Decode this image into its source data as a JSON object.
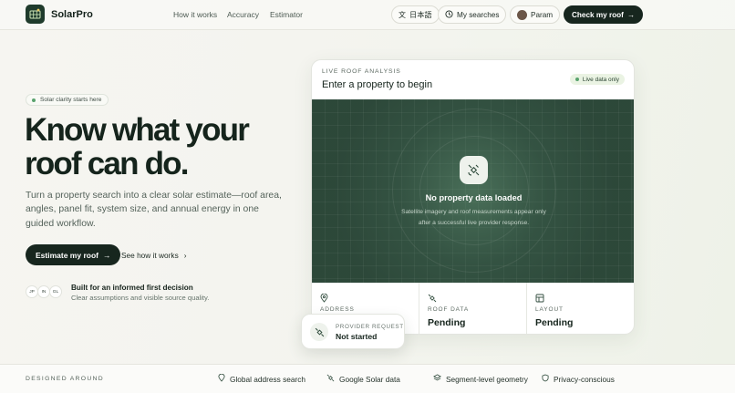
{
  "nav": {
    "brand": "SolarPro",
    "links": [
      "How it works",
      "Accuracy",
      "Estimator"
    ],
    "language": "日本語",
    "my_searches": "My searches",
    "user": "Param",
    "cta": "Check my roof"
  },
  "hero": {
    "badge": "Solar clarity starts here",
    "headline_line1": "Know what your",
    "headline_line2": "roof can do.",
    "subtitle": "Turn a property search into a clear solar estimate—roof area, angles, panel fit, system size, and annual energy in one guided workflow.",
    "primary_cta": "Estimate my roof",
    "secondary_cta": "See how it works",
    "chips": [
      "JP",
      "IN",
      "GL"
    ],
    "trust_title": "Built for an informed first decision",
    "trust_subtitle": "Clear assumptions and visible source quality."
  },
  "analysis_card": {
    "kicker": "LIVE ROOF ANALYSIS",
    "title": "Enter a property to begin",
    "live_badge": "Live data only",
    "map_title": "No property data loaded",
    "map_subtitle_line1": "Satellite imagery and roof measurements appear only",
    "map_subtitle_line2": "after a successful live provider response.",
    "stats": [
      {
        "label": "ADDRESS",
        "value": "",
        "icon": "location-pin-icon"
      },
      {
        "label": "ROOF DATA",
        "value": "Pending",
        "icon": "satellite-icon"
      },
      {
        "label": "LAYOUT",
        "value": "Pending",
        "icon": "grid-layout-icon"
      }
    ],
    "provider": {
      "label": "PROVIDER REQUEST",
      "value": "Not started"
    }
  },
  "footer_strip": {
    "title": "DESIGNED AROUND",
    "features": [
      "Global address search",
      "Google Solar data",
      "Segment-level geometry",
      "Privacy-conscious"
    ]
  },
  "colors": {
    "accent": "#17261e",
    "map": "#2f4b3c",
    "live": "#5aa36e"
  }
}
